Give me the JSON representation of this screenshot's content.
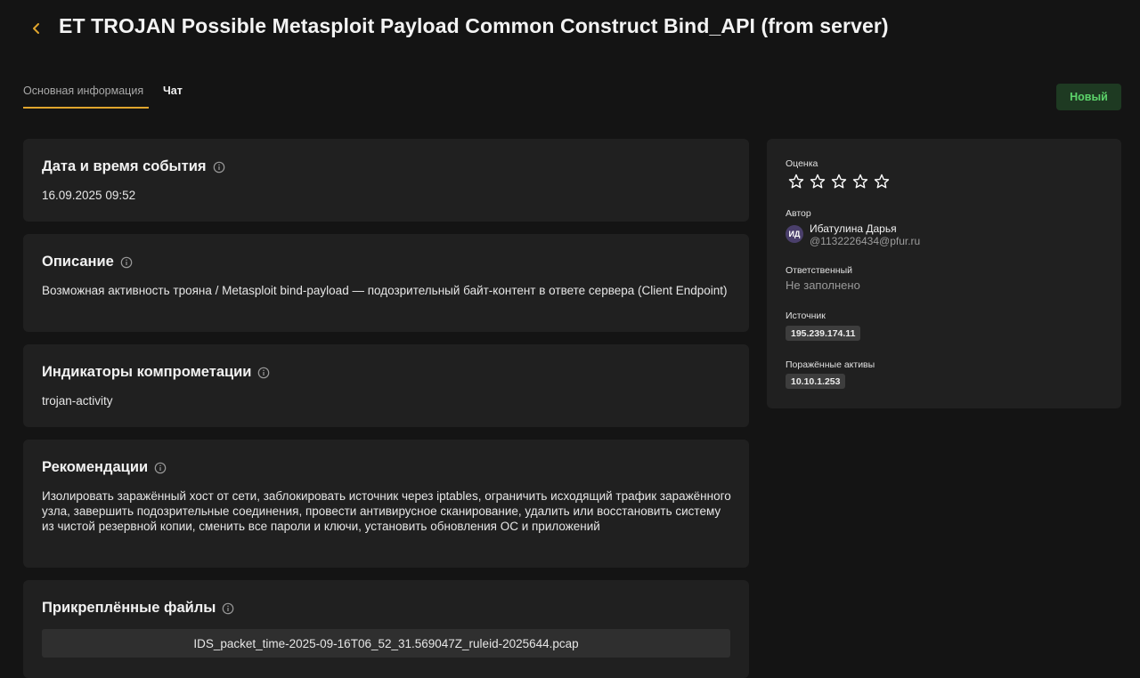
{
  "header": {
    "title": "ET TROJAN Possible Metasploit Payload Common Construct Bind_API (from server)"
  },
  "tabs": [
    {
      "label": "Основная информация",
      "active": true
    },
    {
      "label": "Чат",
      "active": false
    }
  ],
  "status": {
    "label": "Новый",
    "color": "#5cd36a"
  },
  "event_datetime": {
    "title": "Дата и время события",
    "value": "16.09.2025 09:52"
  },
  "description": {
    "title": "Описание",
    "text": "Возможная активность трояна / Metasploit bind-payload — подозрительный байт-контент в ответе сервера (Client Endpoint)"
  },
  "indicators": {
    "title": "Индикаторы компрометации",
    "text": "trojan-activity"
  },
  "recommendations": {
    "title": "Рекомендации",
    "text": "Изолировать заражённый хост от сети, заблокировать источник через iptables, ограничить исходящий трафик заражённого узла, завершить подозрительные соединения, провести антивирусное сканирование, удалить или восстановить систему из чистой резервной копии, сменить все пароли и ключи, установить обновления ОС и приложений"
  },
  "attachments": {
    "title": "Прикреплённые файлы",
    "files": [
      "IDS_packet_time-2025-09-16T06_52_31.569047Z_ruleid-2025644.pcap"
    ]
  },
  "sidebar": {
    "rating": {
      "label": "Оценка",
      "value": 0,
      "max": 5
    },
    "author": {
      "label": "Автор",
      "initials": "ИД",
      "name": "Ибатулина Дарья",
      "email": "@1132226434@pfur.ru"
    },
    "assignee": {
      "label": "Ответственный",
      "value": "Не заполнено"
    },
    "source": {
      "label": "Источник",
      "value": "195.239.174.11"
    },
    "affected_assets": {
      "label": "Поражённые активы",
      "value": "10.10.1.253"
    }
  },
  "colors": {
    "accent": "#e0a52d",
    "background": "#141414",
    "card": "#202020",
    "status_bg": "#1e3a22"
  },
  "icons": {
    "back": "chevron-left-icon",
    "info": "info-icon",
    "star": "star-outline-icon"
  }
}
